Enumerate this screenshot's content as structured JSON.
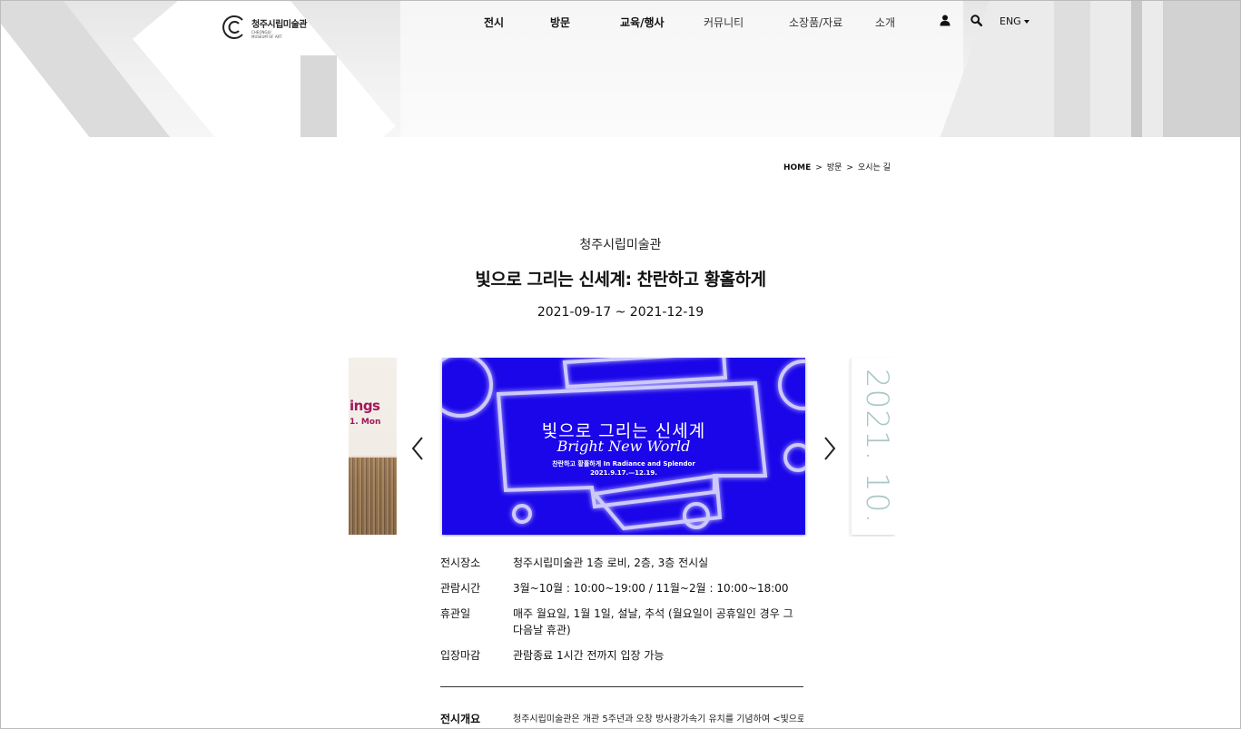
{
  "header": {
    "logo": {
      "name_ko": "청주시립미술관",
      "name_en_line1": "CHEONGJU",
      "name_en_line2": "MUSEUM OF ART"
    },
    "nav": [
      {
        "label": "전시",
        "style": "bold"
      },
      {
        "label": "방문",
        "style": "bold"
      },
      {
        "label": "교육/행사",
        "style": "bold"
      },
      {
        "label": "커뮤니티",
        "style": "light"
      },
      {
        "label": "소장품/자료",
        "style": "light"
      },
      {
        "label": "소개",
        "style": "light"
      }
    ],
    "user_icon": "user-icon",
    "search_icon": "search-icon",
    "language": "ENG"
  },
  "breadcrumb": {
    "home": "HOME",
    "level1": "방문",
    "level2": "오시는 길",
    "separator": ">"
  },
  "exhibition": {
    "museum": "청주시립미술관",
    "title": "빛으로 그리는 신세계: 찬란하고 황홀하게",
    "dates": "2021-09-17 ~ 2021-12-19"
  },
  "carousel": {
    "prev_slide": {
      "text1": "ings",
      "text2": "1. Mon"
    },
    "current_slide": {
      "headline": "빛으로 그리는 신세계",
      "english": "Bright New World",
      "subtitle": "찬란하고 황홀하게 In Radiance and Splendor",
      "dates": "2021.9.17.—12.19.",
      "bg_color": "#1a06e8"
    },
    "next_slide": {
      "text": "2021. 10."
    }
  },
  "info": [
    {
      "key": "전시장소",
      "value": "청주시립미술관 1층 로비, 2층, 3층 전시실"
    },
    {
      "key": "관람시간",
      "value": "3월~10월 : 10:00~19:00 / 11월~2월 : 10:00~18:00"
    },
    {
      "key": "휴관일",
      "value": "매주 월요일, 1월 1일, 설날, 추석 (월요일이 공휴일인 경우 그 다음날 휴관)"
    },
    {
      "key": "입장마감",
      "value": "관람종료 1시간 전까지 입장 가능"
    }
  ],
  "overview": {
    "key": "전시개요",
    "value": "청주시립미술관은 개관 5주년과 오창 방사광가속기 유치를 기념하여 <빛으로"
  }
}
